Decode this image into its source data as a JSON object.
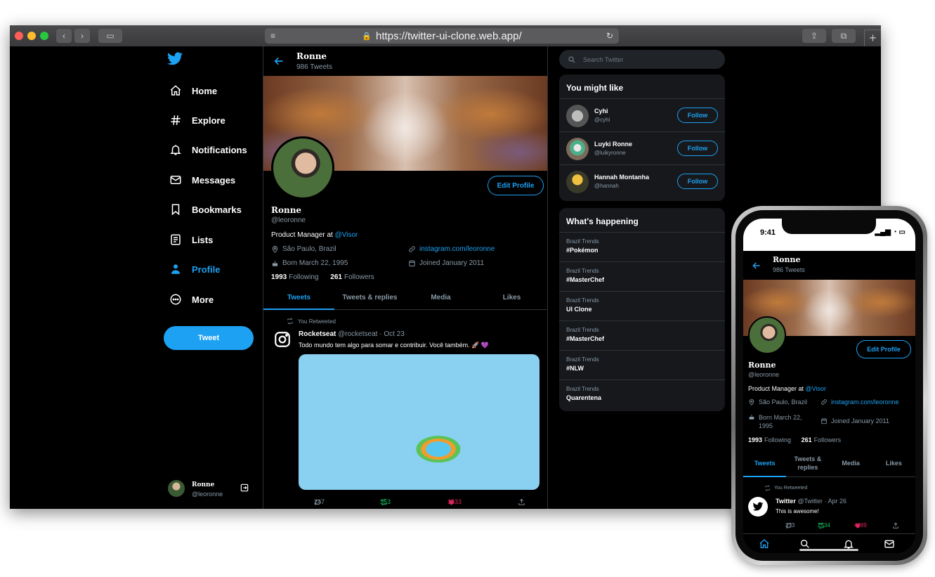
{
  "browser": {
    "url": "https://twitter-ui-clone.web.app/"
  },
  "nav": {
    "items": [
      {
        "label": "Home",
        "icon": "home-icon"
      },
      {
        "label": "Explore",
        "icon": "hashtag-icon"
      },
      {
        "label": "Notifications",
        "icon": "bell-icon"
      },
      {
        "label": "Messages",
        "icon": "mail-icon"
      },
      {
        "label": "Bookmarks",
        "icon": "bookmark-icon"
      },
      {
        "label": "Lists",
        "icon": "list-icon"
      },
      {
        "label": "Profile",
        "icon": "person-icon"
      },
      {
        "label": "More",
        "icon": "more-icon"
      }
    ],
    "tweet_button": "Tweet",
    "user": {
      "name": "Ronne",
      "handle": "@leoronne"
    }
  },
  "profile": {
    "name": "Ronne",
    "tweet_count": "986 Tweets",
    "edit_button": "Edit Profile",
    "handle": "@leoronne",
    "bio_text": "Product Manager at ",
    "bio_link": "@Visor",
    "location": "São Paulo, Brazil",
    "website": "instagram.com/leoronne",
    "birthday": "Born March 22, 1995",
    "joined": "Joined January 2011",
    "following_count": "1993",
    "following_label": "Following",
    "followers_count": "261",
    "followers_label": "Followers",
    "tabs": [
      "Tweets",
      "Tweets & replies",
      "Media",
      "Likes"
    ]
  },
  "tweet": {
    "retweet_note": "You Retweeted",
    "author": "Rocketseat",
    "handle": "@rocketseat",
    "date": "Oct 23",
    "text": "Todo mundo tem algo para somar e contribuir. Você também. 🚀 💜",
    "replies": "247",
    "retweets": "353",
    "likes": "1533"
  },
  "sidebar": {
    "search_placeholder": "Search Twitter",
    "suggestions_title": "You might like",
    "suggestions": [
      {
        "name": "Cyhi",
        "handle": "@cyhi",
        "button": "Follow"
      },
      {
        "name": "Luyki Ronne",
        "handle": "@luikyronne",
        "button": "Follow"
      },
      {
        "name": "Hannah Montanha",
        "handle": "@hannah",
        "button": "Follow"
      }
    ],
    "trends_title": "What's happening",
    "trends": [
      {
        "category": "Brazil Trends",
        "topic": "#Pokémon"
      },
      {
        "category": "Brazil Trends",
        "topic": "#MasterChef"
      },
      {
        "category": "Brazil Trends",
        "topic": "UI Clone"
      },
      {
        "category": "Brazil Trends",
        "topic": "#MasterChef"
      },
      {
        "category": "Brazil Trends",
        "topic": "#NLW"
      },
      {
        "category": "Brazil Trends",
        "topic": "Quarentena"
      }
    ]
  },
  "phone": {
    "time": "9:41",
    "birthday_line1": "Born March 22,",
    "birthday_line2": "1995",
    "tabs": [
      "Tweets",
      "Tweets &",
      "replies",
      "Media",
      "Likes"
    ],
    "tweet": {
      "retweet_note": "You Retweeted",
      "author": "Twitter",
      "handle": "@Twitter",
      "date": "Apr 26",
      "text": "This is awesome!",
      "replies": "373",
      "retweets": "2534",
      "likes": "4289"
    }
  },
  "colors": {
    "accent": "#1da1f2",
    "retweet": "#17bf63",
    "like": "#e0245e",
    "panel": "#16181c"
  }
}
